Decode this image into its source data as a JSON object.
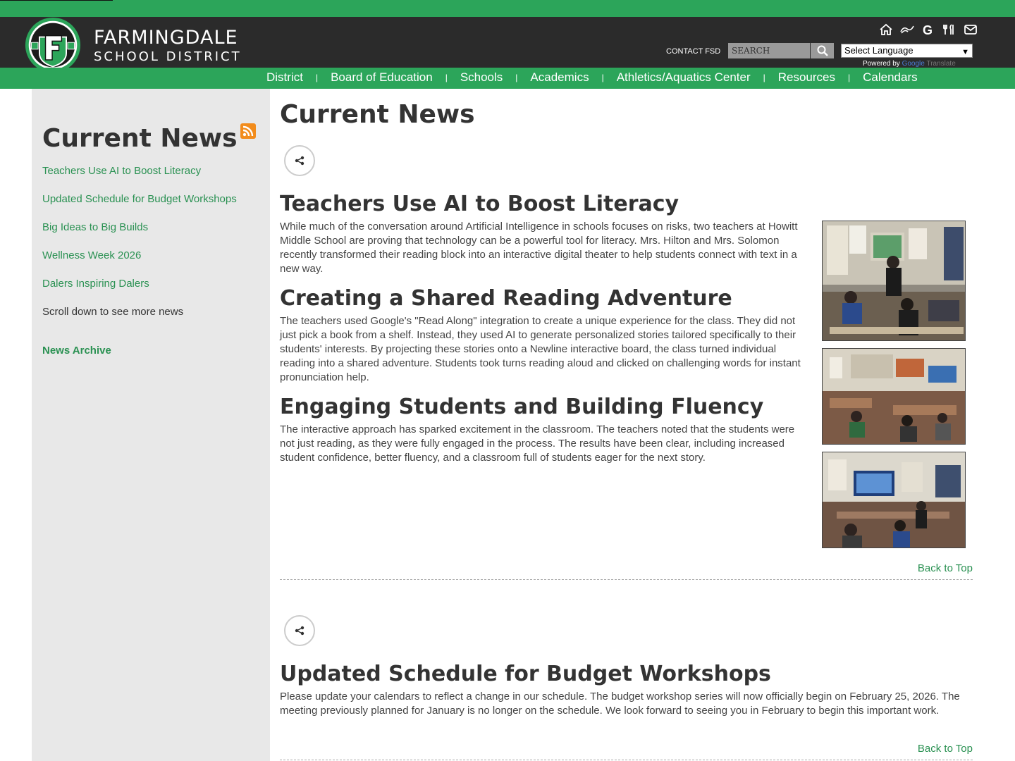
{
  "header": {
    "brand_line1": "FARMINGDALE",
    "brand_line2": "SCHOOL DISTRICT",
    "logo_letter": "F",
    "contact": "CONTACT FSD",
    "search_placeholder": "SEARCH",
    "language_select": "Select Language",
    "powered_by": "Powered by",
    "google": "Google",
    "translate": "Translate",
    "icons": [
      "home-icon",
      "link-icon",
      "google-icon",
      "dining-icon",
      "mail-icon"
    ]
  },
  "nav": {
    "items": [
      "District",
      "Board of Education",
      "Schools",
      "Academics",
      "Athletics/Aquatics Center",
      "Resources",
      "Calendars"
    ]
  },
  "sidebar": {
    "title": "Current News",
    "links": [
      "Teachers Use AI to Boost Literacy",
      "Updated Schedule for Budget Workshops",
      "Big Ideas to Big Builds",
      "Wellness Week 2026",
      "Dalers Inspiring Dalers"
    ],
    "note": "Scroll down to see more news",
    "archive": "News Archive"
  },
  "main": {
    "title": "Current News",
    "article1": {
      "title": "Teachers Use AI to Boost Literacy",
      "p1": "While much of the conversation around Artificial Intelligence in schools focuses on risks, two teachers at Howitt Middle School are proving that technology can be a powerful tool for literacy. Mrs. Hilton and Mrs. Solomon recently transformed their reading block into an interactive digital theater to help students connect with text in a new way.",
      "h2": "Creating a Shared Reading Adventure",
      "p2": "The teachers used Google's \"Read Along\" integration to create a unique experience for the class. They did not just pick a book from a shelf. Instead, they used AI to generate personalized stories tailored specifically to their students' interests. By projecting these stories onto a Newline interactive board, the class turned individual reading into a shared adventure. Students took turns reading aloud and clicked on challenging words for instant pronunciation help.",
      "h3": "Engaging Students and Building Fluency",
      "p3": "The interactive approach has sparked excitement in the classroom. The teachers noted that the students were not just reading, as they were fully engaged in the process. The results have been clear, including increased student confidence, better fluency, and a classroom full of students eager for the next story."
    },
    "back_to_top": "Back to Top",
    "article2": {
      "title": "Updated Schedule for Budget Workshops",
      "p1": "Please update your calendars to reflect a change in our schedule. The budget workshop series will now officially begin on February 25, 2026. The meeting previously planned for January is no longer on the schedule. We look forward to seeing you in February to begin this important work."
    }
  },
  "colors": {
    "green": "#2ca55a",
    "link": "#2a9152",
    "dark": "#2b2b2b",
    "sidebar": "#e8e8e8"
  }
}
